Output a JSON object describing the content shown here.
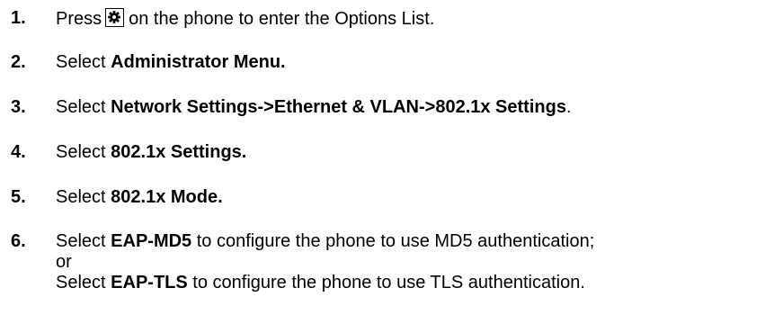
{
  "steps": [
    {
      "number": "1.",
      "before": "Press",
      "icon": "gear-icon",
      "after": "on the phone to enter the Options List."
    },
    {
      "number": "2.",
      "text": "Select ",
      "bold": "Administrator Menu."
    },
    {
      "number": "3.",
      "text": "Select ",
      "bold": "Network Settings->Ethernet & VLAN->802.1x Settings",
      "tail": "."
    },
    {
      "number": "4.",
      "text": "Select ",
      "bold": "802.1x Settings."
    },
    {
      "number": "5.",
      "text": "Select ",
      "bold": "802.1x Mode."
    },
    {
      "number": "6.",
      "line1_text": "Select ",
      "line1_bold": "EAP-MD5",
      "line1_tail": " to configure the phone to use MD5 authentication;",
      "line2": "or",
      "line3_text": "Select ",
      "line3_bold": "EAP-TLS",
      "line3_tail": " to configure the phone to use TLS authentication."
    }
  ]
}
